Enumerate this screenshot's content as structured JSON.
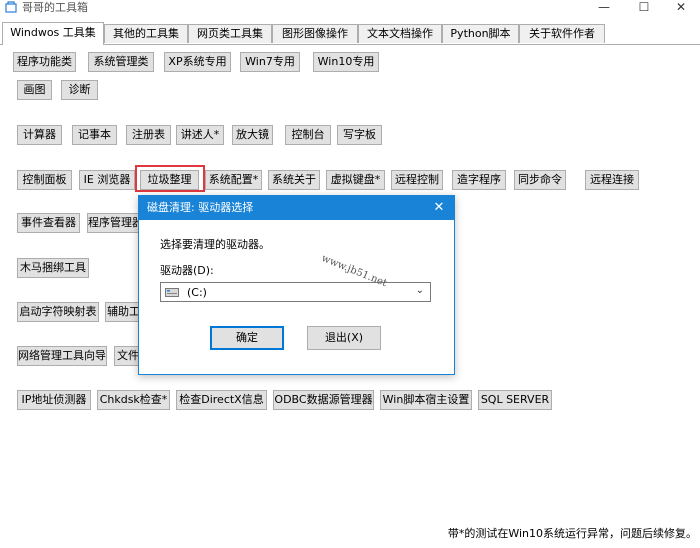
{
  "window": {
    "title": "哥哥的工具箱",
    "controls": {
      "minimize": "—",
      "maximize": "☐",
      "close": "✕"
    }
  },
  "tabs": [
    {
      "label": "Windwos 工具集",
      "active": true
    },
    {
      "label": "其他的工具集"
    },
    {
      "label": "网页类工具集"
    },
    {
      "label": "图形图像操作"
    },
    {
      "label": "文本文档操作"
    },
    {
      "label": "Python脚本"
    },
    {
      "label": "关于软件作者"
    }
  ],
  "buttons": {
    "row1": [
      "程序功能类",
      "系统管理类",
      "XP系统专用",
      "Win7专用",
      "Win10专用"
    ],
    "row2": [
      "画图",
      "诊断"
    ],
    "row3": [
      "计算器",
      "记事本",
      "注册表",
      "讲述人*",
      "放大镜",
      "控制台",
      "写字板"
    ],
    "row4": [
      "控制面板",
      "IE 浏览器",
      "垃圾整理",
      "系统配置*",
      "系统关于",
      "虚拟键盘*",
      "远程控制",
      "造字程序",
      "同步命令",
      "远程连接"
    ],
    "row5": [
      "事件查看器",
      "程序管理器"
    ],
    "row6": [
      "木马捆绑工具"
    ],
    "row7": [
      "启动字符映射表",
      "辅助工"
    ],
    "row8": [
      "网络管理工具向导",
      "文件"
    ],
    "row9": [
      "IP地址侦测器",
      "Chkdsk检查*",
      "检查DirectX信息",
      "ODBC数据源管理器",
      "Win脚本宿主设置",
      "SQL SERVER"
    ]
  },
  "dialog": {
    "title": "磁盘清理: 驱动器选择",
    "close": "✕",
    "prompt": "选择要清理的驱动器。",
    "drive_label": "驱动器(D):",
    "drive_value": "(C:)",
    "arrow": "⌄",
    "ok": "确定",
    "exit": "退出(X)",
    "watermark": "www.jb51.net"
  },
  "footer": "带*的测试在Win10系统运行异常，问题后续修复。",
  "colors": {
    "accent": "#1883d7",
    "highlight": "#e0383f"
  }
}
